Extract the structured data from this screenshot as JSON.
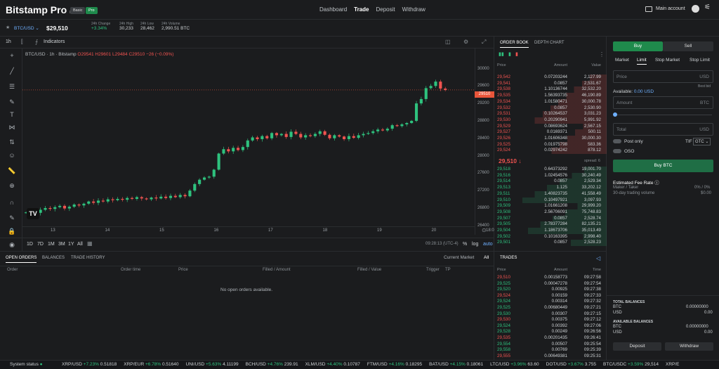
{
  "header": {
    "brand": "Bitstamp Pro",
    "brand_sub": "Inc",
    "pill_basic": "Basic",
    "pill_pro": "Pro",
    "nav": [
      "Dashboard",
      "Trade",
      "Deposit",
      "Withdraw"
    ],
    "account": "Main account"
  },
  "ticker": {
    "pair": "BTC/USD",
    "price": "$29,510",
    "stats": [
      {
        "label": "24h Change",
        "value": "+3.34%"
      },
      {
        "label": "24h High",
        "value": "30,233"
      },
      {
        "label": "24h Low",
        "value": "28,462"
      },
      {
        "label": "24h Volume",
        "value": "2,990.51 BTC"
      }
    ]
  },
  "chart": {
    "interval": "1h",
    "indicators": "Indicators",
    "legend": "BTC/USD · 1h · Bitstamp",
    "o": "O29541",
    "h": "H29601",
    "l": "L29484",
    "c": "C29510",
    "chg": "−26 (−0.09%)",
    "price_tag": "29510",
    "yticks": [
      "30000",
      "29600",
      "29200",
      "28800",
      "28400",
      "28000",
      "27600",
      "27200",
      "26800",
      "26400"
    ],
    "xticks": [
      "13",
      "14",
      "15",
      "16",
      "17",
      "18",
      "19",
      "20",
      "18:0"
    ],
    "ranges": [
      "1D",
      "7D",
      "1M",
      "3M",
      "1Y",
      "All"
    ],
    "time": "09:28:13 (UTC-4)",
    "pct": "%",
    "log": "log",
    "auto": "auto"
  },
  "orders": {
    "tabs": [
      "OPEN ORDERS",
      "BALANCES",
      "TRADE HISTORY"
    ],
    "market": "Current Market",
    "all": "All",
    "columns": [
      "Order",
      "Order time",
      "Price",
      "Filled / Amount",
      "Filled / Value",
      "Trigger",
      "TP"
    ],
    "empty": "No open orders available."
  },
  "orderbook": {
    "tabs": [
      "ORDER BOOK",
      "DEPTH CHART"
    ],
    "columns": [
      "Price",
      "Amount",
      "Value"
    ],
    "asks": [
      [
        "29,542",
        "0.07203244",
        "2,127.99"
      ],
      [
        "29,541",
        "0.0857",
        "2,531.67"
      ],
      [
        "29,538",
        "1.10136744",
        "32,532.20"
      ],
      [
        "29,535",
        "1.56393735",
        "46,190.89"
      ],
      [
        "29,534",
        "1.01580471",
        "30,000.78"
      ],
      [
        "29,532",
        "0.0857",
        "2,530.90"
      ],
      [
        "29,531",
        "0.10264537",
        "3,031.23"
      ],
      [
        "29,530",
        "0.20290941",
        "5,991.92"
      ],
      [
        "29,529",
        "0.08693624",
        "2,567.15"
      ],
      [
        "29,527",
        "0.0169371",
        "500.11"
      ],
      [
        "29,526",
        "1.01606348",
        "30,000.30"
      ],
      [
        "29,525",
        "0.01975798",
        "583.36"
      ],
      [
        "29,524",
        "0.02974242",
        "878.12"
      ]
    ],
    "mid": "29,510",
    "spread": "spread: 6",
    "bids": [
      [
        "29,518",
        "0.64373292",
        "19,001.70"
      ],
      [
        "29,516",
        "1.02454576",
        "30,240.49"
      ],
      [
        "29,514",
        "0.0857",
        "2,529.34"
      ],
      [
        "29,513",
        "1.125",
        "33,202.12"
      ],
      [
        "29,511",
        "1.40823735",
        "41,558.49"
      ],
      [
        "29,510",
        "0.10497921",
        "3,097.93"
      ],
      [
        "29,509",
        "1.01661208",
        "29,999.20"
      ],
      [
        "29,508",
        "2.56706091",
        "75,748.83"
      ],
      [
        "29,507",
        "0.0857",
        "2,528.74"
      ],
      [
        "29,505",
        "2.78377284",
        "82,135.21"
      ],
      [
        "29,504",
        "1.18673706",
        "35,013.49"
      ],
      [
        "29,502",
        "0.10163395",
        "2,998.40"
      ],
      [
        "29,501",
        "0.0857",
        "2,528.23"
      ]
    ]
  },
  "trades": {
    "title": "TRADES",
    "columns": [
      "Price",
      "Amount",
      "Time"
    ],
    "rows": [
      [
        "29,510",
        "0.00158773",
        "09:27:58",
        "r"
      ],
      [
        "29,525",
        "0.00047278",
        "09:27:54",
        "g"
      ],
      [
        "29,520",
        "0.00925",
        "09:27:38",
        "g"
      ],
      [
        "29,524",
        "0.00159",
        "09:27:33",
        "r"
      ],
      [
        "29,524",
        "0.00314",
        "09:27:32",
        "g"
      ],
      [
        "29,525",
        "0.00680449",
        "09:27:21",
        "g"
      ],
      [
        "29,530",
        "0.00307",
        "09:27:15",
        "g"
      ],
      [
        "29,530",
        "0.00375",
        "09:27:12",
        "r"
      ],
      [
        "29,524",
        "0.00392",
        "09:27:06",
        "g"
      ],
      [
        "29,528",
        "0.00249",
        "09:26:56",
        "g"
      ],
      [
        "29,535",
        "0.00201435",
        "09:26:41",
        "r"
      ],
      [
        "29,554",
        "0.00507",
        "09:25:54",
        "g"
      ],
      [
        "29,558",
        "0.00769",
        "09:25:39",
        "g"
      ],
      [
        "29,555",
        "0.00649381",
        "09:25:31",
        "r"
      ]
    ]
  },
  "form": {
    "buy": "Buy",
    "sell": "Sell",
    "types": [
      "Market",
      "Limit",
      "Stop Market",
      "Stop Limit"
    ],
    "price": "Price",
    "usd": "USD",
    "best_bid": "Best bid",
    "available": "Available:",
    "available_val": "0.00 USD",
    "amount": "Amount",
    "btc": "BTC",
    "total": "Total",
    "post_only": "Post only",
    "tif": "TIF",
    "gtc": "GTC",
    "oso": "OSO",
    "buy_btn": "Buy BTC",
    "fee_title": "Estimated Fee Rate",
    "maker_taker": "Maker / Taker",
    "maker_val": "0% / 0%",
    "volume": "30-day trading volume",
    "volume_val": "$0.00",
    "total_bal": "TOTAL BALANCES",
    "avail_bal": "AVAILABLE BALANCES",
    "btc_l": "BTC",
    "usd_l": "USD",
    "btc_v": "0.00000000",
    "usd_v": "0.00",
    "deposit": "Deposit",
    "withdraw": "Withdraw"
  },
  "status": {
    "label": "System status",
    "items": [
      [
        "XRP/USD",
        "+7.23%",
        "0.51818"
      ],
      [
        "XRP/EUR",
        "+6.78%",
        "0.51640"
      ],
      [
        "UNI/USD",
        "+5.63%",
        "4.11199"
      ],
      [
        "BCH/USD",
        "+4.76%",
        "239.91"
      ],
      [
        "XLM/USD",
        "+4.40%",
        "0.10787"
      ],
      [
        "FTM/USD",
        "+4.16%",
        "0.18295"
      ],
      [
        "BAT/USD",
        "+4.15%",
        "0.18061"
      ],
      [
        "LTC/USD",
        "+3.96%",
        "63.60"
      ],
      [
        "DOT/USD",
        "+3.67%",
        "3.755"
      ],
      [
        "BTC/USDC",
        "+3.59%",
        "29,514"
      ],
      [
        "XRP/E",
        "",
        " "
      ]
    ]
  },
  "chart_data": {
    "type": "candlestick",
    "x": [
      "13",
      "14",
      "15",
      "16",
      "17",
      "18",
      "19",
      "20"
    ],
    "ylim": [
      26300,
      30250
    ],
    "closes": [
      26700,
      26720,
      26690,
      26760,
      26800,
      26780,
      26820,
      26850,
      26790,
      26830,
      26880,
      26860,
      26900,
      26950,
      26920,
      26970,
      26950,
      27000,
      26980,
      27010,
      26990,
      27030,
      27010,
      27050,
      27020,
      27000,
      27040,
      27020,
      27060,
      27030,
      27080,
      27050,
      27100,
      27070,
      27200,
      27350,
      27450,
      27500,
      27520,
      27680,
      28050,
      28150,
      28100,
      28180,
      28130,
      28200,
      28350,
      28420,
      28380,
      28450,
      28400,
      28520,
      28470,
      28500,
      28430,
      28550,
      28500,
      28420,
      28470,
      28450,
      28500,
      28560,
      28480,
      28400,
      28470,
      28440,
      28380,
      28450,
      28410,
      28470,
      28500,
      28520,
      28560,
      28600,
      28580,
      28620,
      28700,
      28680,
      28720,
      28750,
      28800,
      29200,
      29300,
      29550,
      29600,
      29700,
      29540,
      29510
    ]
  }
}
